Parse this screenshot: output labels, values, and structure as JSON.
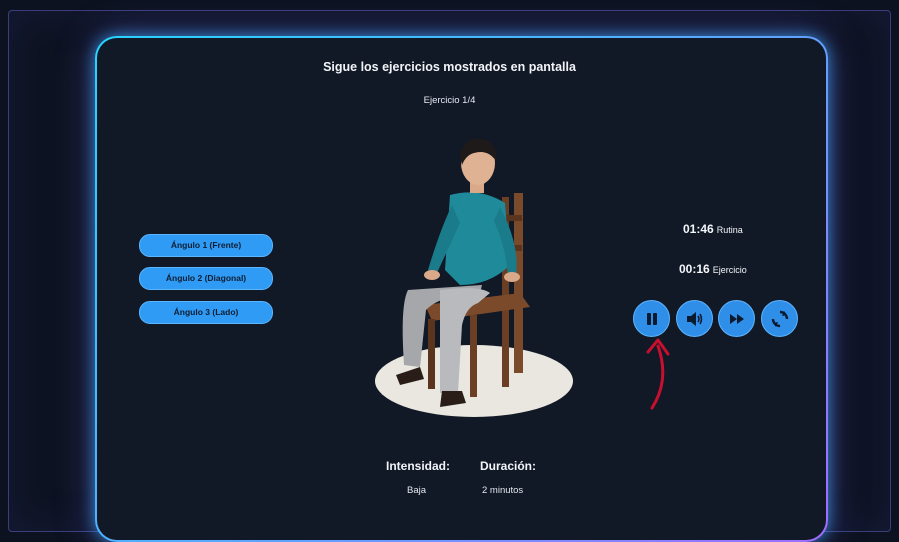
{
  "header": {
    "title": "Sigue los ejercicios mostrados en pantalla",
    "exercise_counter": "Ejercicio 1/4"
  },
  "angles": [
    {
      "label": "Ángulo 1 (Frente)"
    },
    {
      "label": "Ángulo 2 (Diagonal)"
    },
    {
      "label": "Ángulo 3 (Lado)"
    }
  ],
  "timers": {
    "routine": {
      "time": "01:46",
      "label": "Rutina"
    },
    "exercise": {
      "time": "00:16",
      "label": "Ejercicio"
    }
  },
  "controls": {
    "icons": [
      "pause-icon",
      "volume-icon",
      "skip-forward-icon",
      "restart-icon"
    ]
  },
  "info": {
    "intensity_label": "Intensidad:",
    "intensity_value": "Baja",
    "duration_label": "Duración:",
    "duration_value": "2 minutos"
  },
  "colors": {
    "accent": "#2f8fe8",
    "glow": "#27d4ff",
    "annotation_arrow": "#c8102e"
  }
}
